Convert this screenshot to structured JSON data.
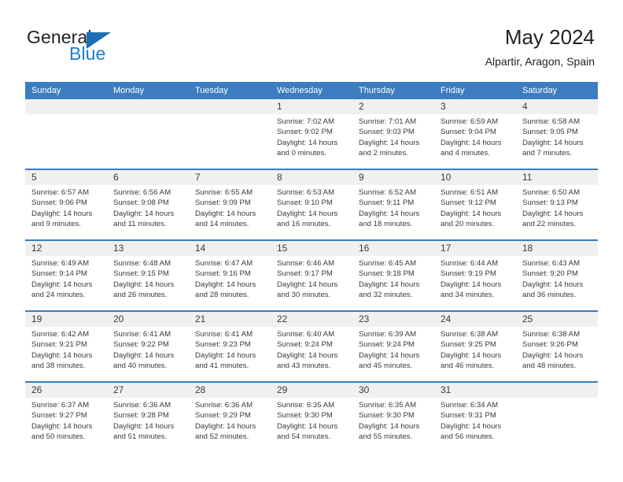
{
  "brand": {
    "name_part1": "General",
    "name_part2": "Blue",
    "triangle_color": "#1d6fb5",
    "blue_text_color": "#1c7fc4"
  },
  "header": {
    "title": "May 2024",
    "location": "Alpartir, Aragon, Spain"
  },
  "theme": {
    "header_blue": "#3b7dc0",
    "daynum_band": "#f0f0f0",
    "text": "#3a3a3a"
  },
  "weekday_headers": [
    "Sunday",
    "Monday",
    "Tuesday",
    "Wednesday",
    "Thursday",
    "Friday",
    "Saturday"
  ],
  "labels": {
    "sunrise_prefix": "Sunrise:",
    "sunset_prefix": "Sunset:",
    "daylight_prefix": "Daylight:"
  },
  "weeks": [
    [
      {
        "day": "",
        "sunrise": "",
        "sunset": "",
        "daylight_line1": "",
        "daylight_line2": "",
        "empty": true
      },
      {
        "day": "",
        "sunrise": "",
        "sunset": "",
        "daylight_line1": "",
        "daylight_line2": "",
        "empty": true
      },
      {
        "day": "",
        "sunrise": "",
        "sunset": "",
        "daylight_line1": "",
        "daylight_line2": "",
        "empty": true
      },
      {
        "day": "1",
        "sunrise": "Sunrise: 7:02 AM",
        "sunset": "Sunset: 9:02 PM",
        "daylight_line1": "Daylight: 14 hours",
        "daylight_line2": "and 0 minutes."
      },
      {
        "day": "2",
        "sunrise": "Sunrise: 7:01 AM",
        "sunset": "Sunset: 9:03 PM",
        "daylight_line1": "Daylight: 14 hours",
        "daylight_line2": "and 2 minutes."
      },
      {
        "day": "3",
        "sunrise": "Sunrise: 6:59 AM",
        "sunset": "Sunset: 9:04 PM",
        "daylight_line1": "Daylight: 14 hours",
        "daylight_line2": "and 4 minutes."
      },
      {
        "day": "4",
        "sunrise": "Sunrise: 6:58 AM",
        "sunset": "Sunset: 9:05 PM",
        "daylight_line1": "Daylight: 14 hours",
        "daylight_line2": "and 7 minutes."
      }
    ],
    [
      {
        "day": "5",
        "sunrise": "Sunrise: 6:57 AM",
        "sunset": "Sunset: 9:06 PM",
        "daylight_line1": "Daylight: 14 hours",
        "daylight_line2": "and 9 minutes."
      },
      {
        "day": "6",
        "sunrise": "Sunrise: 6:56 AM",
        "sunset": "Sunset: 9:08 PM",
        "daylight_line1": "Daylight: 14 hours",
        "daylight_line2": "and 11 minutes."
      },
      {
        "day": "7",
        "sunrise": "Sunrise: 6:55 AM",
        "sunset": "Sunset: 9:09 PM",
        "daylight_line1": "Daylight: 14 hours",
        "daylight_line2": "and 14 minutes."
      },
      {
        "day": "8",
        "sunrise": "Sunrise: 6:53 AM",
        "sunset": "Sunset: 9:10 PM",
        "daylight_line1": "Daylight: 14 hours",
        "daylight_line2": "and 16 minutes."
      },
      {
        "day": "9",
        "sunrise": "Sunrise: 6:52 AM",
        "sunset": "Sunset: 9:11 PM",
        "daylight_line1": "Daylight: 14 hours",
        "daylight_line2": "and 18 minutes."
      },
      {
        "day": "10",
        "sunrise": "Sunrise: 6:51 AM",
        "sunset": "Sunset: 9:12 PM",
        "daylight_line1": "Daylight: 14 hours",
        "daylight_line2": "and 20 minutes."
      },
      {
        "day": "11",
        "sunrise": "Sunrise: 6:50 AM",
        "sunset": "Sunset: 9:13 PM",
        "daylight_line1": "Daylight: 14 hours",
        "daylight_line2": "and 22 minutes."
      }
    ],
    [
      {
        "day": "12",
        "sunrise": "Sunrise: 6:49 AM",
        "sunset": "Sunset: 9:14 PM",
        "daylight_line1": "Daylight: 14 hours",
        "daylight_line2": "and 24 minutes."
      },
      {
        "day": "13",
        "sunrise": "Sunrise: 6:48 AM",
        "sunset": "Sunset: 9:15 PM",
        "daylight_line1": "Daylight: 14 hours",
        "daylight_line2": "and 26 minutes."
      },
      {
        "day": "14",
        "sunrise": "Sunrise: 6:47 AM",
        "sunset": "Sunset: 9:16 PM",
        "daylight_line1": "Daylight: 14 hours",
        "daylight_line2": "and 28 minutes."
      },
      {
        "day": "15",
        "sunrise": "Sunrise: 6:46 AM",
        "sunset": "Sunset: 9:17 PM",
        "daylight_line1": "Daylight: 14 hours",
        "daylight_line2": "and 30 minutes."
      },
      {
        "day": "16",
        "sunrise": "Sunrise: 6:45 AM",
        "sunset": "Sunset: 9:18 PM",
        "daylight_line1": "Daylight: 14 hours",
        "daylight_line2": "and 32 minutes."
      },
      {
        "day": "17",
        "sunrise": "Sunrise: 6:44 AM",
        "sunset": "Sunset: 9:19 PM",
        "daylight_line1": "Daylight: 14 hours",
        "daylight_line2": "and 34 minutes."
      },
      {
        "day": "18",
        "sunrise": "Sunrise: 6:43 AM",
        "sunset": "Sunset: 9:20 PM",
        "daylight_line1": "Daylight: 14 hours",
        "daylight_line2": "and 36 minutes."
      }
    ],
    [
      {
        "day": "19",
        "sunrise": "Sunrise: 6:42 AM",
        "sunset": "Sunset: 9:21 PM",
        "daylight_line1": "Daylight: 14 hours",
        "daylight_line2": "and 38 minutes."
      },
      {
        "day": "20",
        "sunrise": "Sunrise: 6:41 AM",
        "sunset": "Sunset: 9:22 PM",
        "daylight_line1": "Daylight: 14 hours",
        "daylight_line2": "and 40 minutes."
      },
      {
        "day": "21",
        "sunrise": "Sunrise: 6:41 AM",
        "sunset": "Sunset: 9:23 PM",
        "daylight_line1": "Daylight: 14 hours",
        "daylight_line2": "and 41 minutes."
      },
      {
        "day": "22",
        "sunrise": "Sunrise: 6:40 AM",
        "sunset": "Sunset: 9:24 PM",
        "daylight_line1": "Daylight: 14 hours",
        "daylight_line2": "and 43 minutes."
      },
      {
        "day": "23",
        "sunrise": "Sunrise: 6:39 AM",
        "sunset": "Sunset: 9:24 PM",
        "daylight_line1": "Daylight: 14 hours",
        "daylight_line2": "and 45 minutes."
      },
      {
        "day": "24",
        "sunrise": "Sunrise: 6:38 AM",
        "sunset": "Sunset: 9:25 PM",
        "daylight_line1": "Daylight: 14 hours",
        "daylight_line2": "and 46 minutes."
      },
      {
        "day": "25",
        "sunrise": "Sunrise: 6:38 AM",
        "sunset": "Sunset: 9:26 PM",
        "daylight_line1": "Daylight: 14 hours",
        "daylight_line2": "and 48 minutes."
      }
    ],
    [
      {
        "day": "26",
        "sunrise": "Sunrise: 6:37 AM",
        "sunset": "Sunset: 9:27 PM",
        "daylight_line1": "Daylight: 14 hours",
        "daylight_line2": "and 50 minutes."
      },
      {
        "day": "27",
        "sunrise": "Sunrise: 6:36 AM",
        "sunset": "Sunset: 9:28 PM",
        "daylight_line1": "Daylight: 14 hours",
        "daylight_line2": "and 51 minutes."
      },
      {
        "day": "28",
        "sunrise": "Sunrise: 6:36 AM",
        "sunset": "Sunset: 9:29 PM",
        "daylight_line1": "Daylight: 14 hours",
        "daylight_line2": "and 52 minutes."
      },
      {
        "day": "29",
        "sunrise": "Sunrise: 6:35 AM",
        "sunset": "Sunset: 9:30 PM",
        "daylight_line1": "Daylight: 14 hours",
        "daylight_line2": "and 54 minutes."
      },
      {
        "day": "30",
        "sunrise": "Sunrise: 6:35 AM",
        "sunset": "Sunset: 9:30 PM",
        "daylight_line1": "Daylight: 14 hours",
        "daylight_line2": "and 55 minutes."
      },
      {
        "day": "31",
        "sunrise": "Sunrise: 6:34 AM",
        "sunset": "Sunset: 9:31 PM",
        "daylight_line1": "Daylight: 14 hours",
        "daylight_line2": "and 56 minutes."
      },
      {
        "day": "",
        "sunrise": "",
        "sunset": "",
        "daylight_line1": "",
        "daylight_line2": "",
        "empty": true
      }
    ]
  ]
}
